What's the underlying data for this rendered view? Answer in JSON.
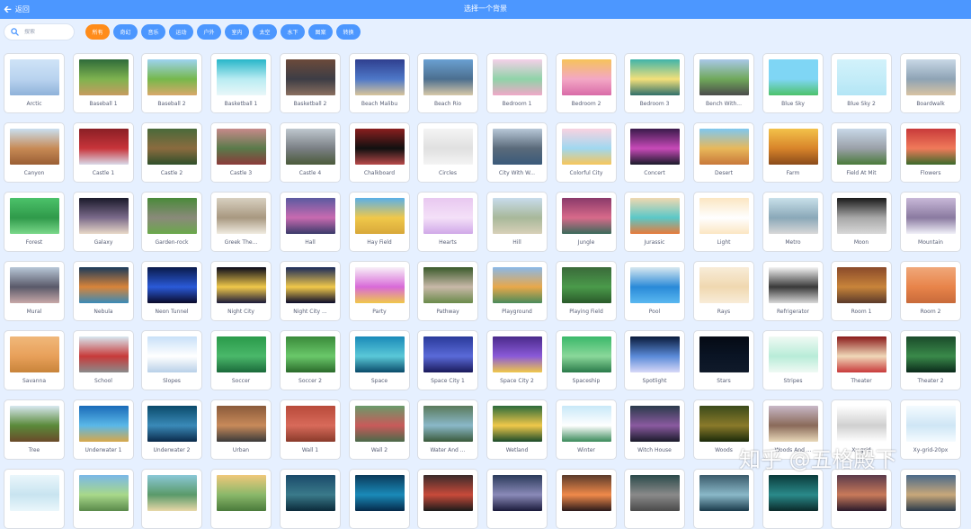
{
  "header": {
    "back_label": "返回",
    "title": "选择一个背景"
  },
  "search": {
    "placeholder": "搜索",
    "value": ""
  },
  "filters": [
    {
      "label": "所有",
      "active": true
    },
    {
      "label": "奇幻",
      "active": false
    },
    {
      "label": "音乐",
      "active": false
    },
    {
      "label": "运动",
      "active": false
    },
    {
      "label": "户外",
      "active": false
    },
    {
      "label": "室内",
      "active": false
    },
    {
      "label": "太空",
      "active": false
    },
    {
      "label": "水下",
      "active": false
    },
    {
      "label": "图案",
      "active": false
    },
    {
      "label": "转换",
      "active": false
    }
  ],
  "backdrops": [
    {
      "label": "Arctic",
      "colors": [
        "#cfe3f7",
        "#b9d3ef",
        "#8fb2d9"
      ]
    },
    {
      "label": "Baseball 1",
      "colors": [
        "#2f6b3a",
        "#7fb34f",
        "#c79b5f"
      ]
    },
    {
      "label": "Baseball 2",
      "colors": [
        "#9dd3f0",
        "#76b84b",
        "#d9a86a"
      ]
    },
    {
      "label": "Basketball 1",
      "colors": [
        "#27b6c9",
        "#b9ecf2",
        "#e9f7f9"
      ]
    },
    {
      "label": "Basketball 2",
      "colors": [
        "#6b4a3a",
        "#3d3d45",
        "#8a6f5f"
      ]
    },
    {
      "label": "Beach Malibu",
      "colors": [
        "#2f3f8f",
        "#4e78c8",
        "#d9c59a"
      ]
    },
    {
      "label": "Beach Rio",
      "colors": [
        "#6aa0d2",
        "#4c6f8f",
        "#d8c8a8"
      ]
    },
    {
      "label": "Bedroom 1",
      "colors": [
        "#f4d0e8",
        "#8fd3a8",
        "#f0a8c8"
      ]
    },
    {
      "label": "Bedroom 2",
      "colors": [
        "#f6c35a",
        "#f3a7c5",
        "#d96ba8"
      ]
    },
    {
      "label": "Bedroom 3",
      "colors": [
        "#3fb4a9",
        "#f3e07a",
        "#2f6f6a"
      ]
    },
    {
      "label": "Bench With...",
      "colors": [
        "#a9c8e8",
        "#6fa85a",
        "#4b4b4b"
      ]
    },
    {
      "label": "Blue Sky",
      "colors": [
        "#7fd6f5",
        "#7fd6f5",
        "#4cc26a"
      ]
    },
    {
      "label": "Blue Sky 2",
      "colors": [
        "#d2f2fb",
        "#c3ecf8",
        "#b3e5f5"
      ]
    },
    {
      "label": "Boardwalk",
      "colors": [
        "#c8d8e6",
        "#8ea3b5",
        "#d8c3a3"
      ]
    },
    {
      "label": "Canyon",
      "colors": [
        "#c9dff0",
        "#c78a55",
        "#9a5e34"
      ]
    },
    {
      "label": "Castle 1",
      "colors": [
        "#8a1f25",
        "#c8343a",
        "#d9d9e8"
      ]
    },
    {
      "label": "Castle 2",
      "colors": [
        "#4a6a3a",
        "#8b6b3f",
        "#2f4f2a"
      ]
    },
    {
      "label": "Castle 3",
      "colors": [
        "#c78a8a",
        "#5a7a4a",
        "#8b3a3a"
      ]
    },
    {
      "label": "Castle 4",
      "colors": [
        "#bfc8cf",
        "#7a7f84",
        "#4a5a3a"
      ]
    },
    {
      "label": "Chalkboard",
      "colors": [
        "#8a1f1f",
        "#101010",
        "#b84a4a"
      ]
    },
    {
      "label": "Circles",
      "colors": [
        "#f4f4f4",
        "#e0e0e0",
        "#f4f4f4"
      ]
    },
    {
      "label": "City With W...",
      "colors": [
        "#b8c8d8",
        "#5a6a7a",
        "#3a5a7a"
      ]
    },
    {
      "label": "Colorful City",
      "colors": [
        "#f9d2e0",
        "#9fd8f0",
        "#f7c65a"
      ]
    },
    {
      "label": "Concert",
      "colors": [
        "#3a1a4a",
        "#c84ab8",
        "#1a1a2a"
      ]
    },
    {
      "label": "Desert",
      "colors": [
        "#7fc8f0",
        "#e8b85a",
        "#c8783a"
      ]
    },
    {
      "label": "Farm",
      "colors": [
        "#f3c24a",
        "#d8842a",
        "#8a4a1a"
      ]
    },
    {
      "label": "Field At Mit",
      "colors": [
        "#c8d8e8",
        "#9aa0a8",
        "#4a7a3a"
      ]
    },
    {
      "label": "Flowers",
      "colors": [
        "#c83a3a",
        "#f07a5a",
        "#3a6a2a"
      ]
    },
    {
      "label": "Forest",
      "colors": [
        "#4cc26a",
        "#2f9a4a",
        "#7ad88a"
      ]
    },
    {
      "label": "Galaxy",
      "colors": [
        "#1a1a2a",
        "#7a6a8a",
        "#e8d8c8"
      ]
    },
    {
      "label": "Garden-rock",
      "colors": [
        "#4a8a3a",
        "#8a8a7a",
        "#6aa84a"
      ]
    },
    {
      "label": "Greek The...",
      "colors": [
        "#d8d0c0",
        "#a89880",
        "#f0ebe0"
      ]
    },
    {
      "label": "Hall",
      "colors": [
        "#5a5aa0",
        "#c86ab0",
        "#3a3a6a"
      ]
    },
    {
      "label": "Hay Field",
      "colors": [
        "#5ab0e8",
        "#f0c84a",
        "#d8a83a"
      ]
    },
    {
      "label": "Hearts",
      "colors": [
        "#e8c8f0",
        "#f4e0f8",
        "#d0a8e8"
      ]
    },
    {
      "label": "Hill",
      "colors": [
        "#c8dcec",
        "#a8b89a",
        "#d8d0b8"
      ]
    },
    {
      "label": "Jungle",
      "colors": [
        "#8a3a6a",
        "#d86a8a",
        "#3a6a5a"
      ]
    },
    {
      "label": "Jurassic",
      "colors": [
        "#f0d8b0",
        "#5ac8c8",
        "#e87a3a"
      ]
    },
    {
      "label": "Light",
      "colors": [
        "#fbe6c2",
        "#ffffff",
        "#fbe6c2"
      ]
    },
    {
      "label": "Metro",
      "colors": [
        "#c8e0ea",
        "#8aa8b8",
        "#d8d8d8"
      ]
    },
    {
      "label": "Moon",
      "colors": [
        "#1a1a1a",
        "#a8a8a8",
        "#d8d8d8"
      ]
    },
    {
      "label": "Mountain",
      "colors": [
        "#c8b8d8",
        "#8a7aa0",
        "#f0f0f8"
      ]
    },
    {
      "label": "Mural",
      "colors": [
        "#b8c8d8",
        "#5a5a6a",
        "#c8a8a8"
      ]
    },
    {
      "label": "Nebula",
      "colors": [
        "#1a3a5a",
        "#d8843a",
        "#3a8ab8"
      ]
    },
    {
      "label": "Neon Tunnel",
      "colors": [
        "#0a1a4a",
        "#2a5ad8",
        "#0a0a2a"
      ]
    },
    {
      "label": "Night City",
      "colors": [
        "#0a0a1a",
        "#f0c84a",
        "#1a1a3a"
      ]
    },
    {
      "label": "Night City ...",
      "colors": [
        "#1a2a5a",
        "#f0c84a",
        "#0a0a2a"
      ]
    },
    {
      "label": "Party",
      "colors": [
        "#f8f0f8",
        "#d86ad8",
        "#f0c84a"
      ]
    },
    {
      "label": "Pathway",
      "colors": [
        "#3a5a2a",
        "#c8b8a8",
        "#6a8a4a"
      ]
    },
    {
      "label": "Playground",
      "colors": [
        "#8ab8e8",
        "#e8a84a",
        "#4a8a5a"
      ]
    },
    {
      "label": "Playing Field",
      "colors": [
        "#3a6a3a",
        "#4a9a4a",
        "#2a5a2a"
      ]
    },
    {
      "label": "Pool",
      "colors": [
        "#d8e8f0",
        "#2a8ad8",
        "#5ab8f0"
      ]
    },
    {
      "label": "Rays",
      "colors": [
        "#f8ecd8",
        "#f0d8b0",
        "#f8ecd8"
      ]
    },
    {
      "label": "Refrigerator",
      "colors": [
        "#f4f4f4",
        "#3a3a3a",
        "#d8d8d8"
      ]
    },
    {
      "label": "Room 1",
      "colors": [
        "#8a4a2a",
        "#c8843a",
        "#5a3a2a"
      ]
    },
    {
      "label": "Room 2",
      "colors": [
        "#f0a87a",
        "#e8844a",
        "#c86a3a"
      ]
    },
    {
      "label": "Savanna",
      "colors": [
        "#f0b87a",
        "#e8a05a",
        "#c8843a"
      ]
    },
    {
      "label": "School",
      "colors": [
        "#d8e8f0",
        "#c83a3a",
        "#8a8a8a"
      ]
    },
    {
      "label": "Slopes",
      "colors": [
        "#c8e0f8",
        "#ffffff",
        "#b8d0e8"
      ]
    },
    {
      "label": "Soccer",
      "colors": [
        "#2a9a4a",
        "#4ab86a",
        "#1a6a3a"
      ]
    },
    {
      "label": "Soccer 2",
      "colors": [
        "#3a8a3a",
        "#6ac86a",
        "#2a6a2a"
      ]
    },
    {
      "label": "Space",
      "colors": [
        "#1a8ab8",
        "#5ac8d8",
        "#0a4a6a"
      ]
    },
    {
      "label": "Space City 1",
      "colors": [
        "#2a3a9a",
        "#5a6ad8",
        "#1a1a5a"
      ]
    },
    {
      "label": "Space City 2",
      "colors": [
        "#4a2a8a",
        "#8a5ad8",
        "#f0c84a"
      ]
    },
    {
      "label": "Spaceship",
      "colors": [
        "#3ab86a",
        "#8ad89a",
        "#2a7a4a"
      ]
    },
    {
      "label": "Spotlight",
      "colors": [
        "#0a1a3a",
        "#5a8ad8",
        "#d8d8f8"
      ]
    },
    {
      "label": "Stars",
      "colors": [
        "#050a14",
        "#0a1424",
        "#101a2a"
      ]
    },
    {
      "label": "Stripes",
      "colors": [
        "#f0faf4",
        "#b8ecd8",
        "#f0faf4"
      ]
    },
    {
      "label": "Theater",
      "colors": [
        "#8a1a1a",
        "#f0d8b8",
        "#c83a3a"
      ]
    },
    {
      "label": "Theater 2",
      "colors": [
        "#1a4a2a",
        "#3a8a4a",
        "#0a2a1a"
      ]
    },
    {
      "label": "Tree",
      "colors": [
        "#d8e8f0",
        "#5a8a3a",
        "#6a4a2a"
      ]
    },
    {
      "label": "Underwater 1",
      "colors": [
        "#1a6ab8",
        "#5ab8e8",
        "#d8a84a"
      ]
    },
    {
      "label": "Underwater 2",
      "colors": [
        "#0a4a6a",
        "#3a8ab8",
        "#0a2a4a"
      ]
    },
    {
      "label": "Urban",
      "colors": [
        "#8a5a3a",
        "#c88a5a",
        "#3a3a3a"
      ]
    },
    {
      "label": "Wall 1",
      "colors": [
        "#b84a3a",
        "#d86a5a",
        "#8a3a2a"
      ]
    },
    {
      "label": "Wall 2",
      "colors": [
        "#6a9a6a",
        "#c85a5a",
        "#4a6a4a"
      ]
    },
    {
      "label": "Water And ...",
      "colors": [
        "#5a7a5a",
        "#8ab8c8",
        "#3a5a3a"
      ]
    },
    {
      "label": "Wetland",
      "colors": [
        "#2a6a3a",
        "#f0c84a",
        "#1a4a2a"
      ]
    },
    {
      "label": "Winter",
      "colors": [
        "#c8e8f8",
        "#ffffff",
        "#3a8a5a"
      ]
    },
    {
      "label": "Witch House",
      "colors": [
        "#2a3a4a",
        "#8a5aa0",
        "#1a1a2a"
      ]
    },
    {
      "label": "Woods",
      "colors": [
        "#3a4a1a",
        "#8a7a2a",
        "#1a2a0a"
      ]
    },
    {
      "label": "Woods And ...",
      "colors": [
        "#c8b8c8",
        "#8a6a5a",
        "#e8d8b8"
      ]
    },
    {
      "label": "Xy-grid",
      "colors": [
        "#ffffff",
        "#d0d0d0",
        "#ffffff"
      ]
    },
    {
      "label": "Xy-grid-20px",
      "colors": [
        "#f4fbff",
        "#cfe6f5",
        "#f4fbff"
      ]
    },
    {
      "label": "",
      "colors": [
        "#eaf6fb",
        "#c8e4f0",
        "#eaf6fb"
      ]
    },
    {
      "label": "",
      "colors": [
        "#7ab8e8",
        "#a8d88a",
        "#5a8a4a"
      ]
    },
    {
      "label": "",
      "colors": [
        "#8ac8d8",
        "#5a9a6a",
        "#e8d8a8"
      ]
    },
    {
      "label": "",
      "colors": [
        "#f0c87a",
        "#8ab86a",
        "#4a7a3a"
      ]
    },
    {
      "label": "",
      "colors": [
        "#1a4a6a",
        "#3a7a8a",
        "#0a2a3a"
      ]
    },
    {
      "label": "",
      "colors": [
        "#0a3a5a",
        "#1a8ab8",
        "#052a4a"
      ]
    },
    {
      "label": "",
      "colors": [
        "#3a2a2a",
        "#c84a3a",
        "#1a1a1a"
      ]
    },
    {
      "label": "",
      "colors": [
        "#2a3a5a",
        "#8a8ab8",
        "#1a1a3a"
      ]
    },
    {
      "label": "",
      "colors": [
        "#5a3a2a",
        "#f08a4a",
        "#2a1a1a"
      ]
    },
    {
      "label": "",
      "colors": [
        "#2a4a4a",
        "#8a8a8a",
        "#4a4a4a"
      ]
    },
    {
      "label": "",
      "colors": [
        "#3a5a6a",
        "#8ab8c8",
        "#1a3a4a"
      ]
    },
    {
      "label": "",
      "colors": [
        "#0a3a3a",
        "#2a8a8a",
        "#0a2a2a"
      ]
    },
    {
      "label": "",
      "colors": [
        "#5a3a4a",
        "#c87a5a",
        "#2a1a2a"
      ]
    },
    {
      "label": "",
      "colors": [
        "#4a6a8a",
        "#c8a87a",
        "#2a3a4a"
      ]
    }
  ],
  "watermark": "知乎 @五格殿下",
  "colors": {
    "accent": "#4c97ff",
    "active_tag": "#ff8c1a",
    "background": "#e6f0ff",
    "card_border": "#d9dde4",
    "label_text": "#575e75"
  }
}
